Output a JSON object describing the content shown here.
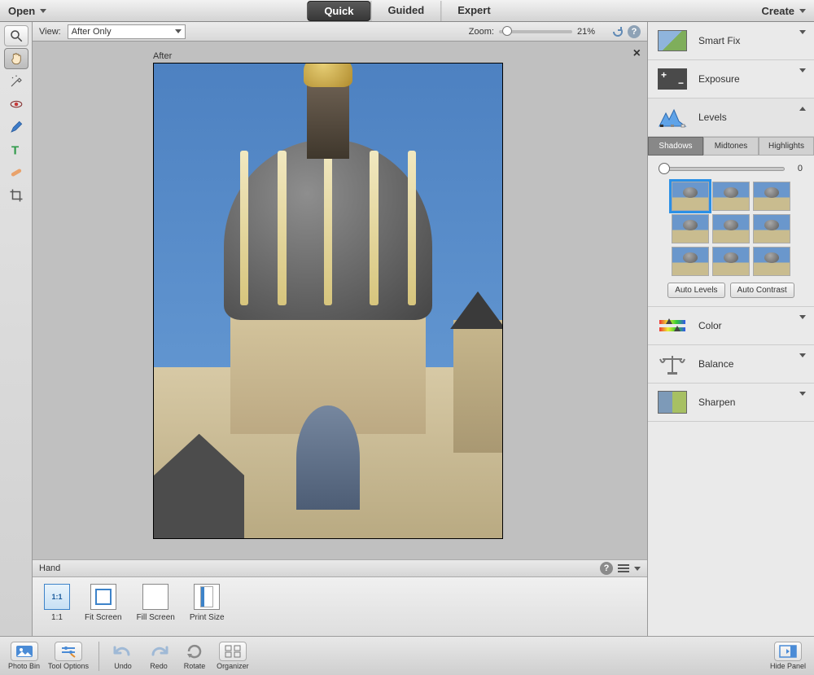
{
  "menubar": {
    "open": "Open",
    "modes": [
      "Quick",
      "Guided",
      "Expert"
    ],
    "active_mode": "Quick",
    "create": "Create"
  },
  "viewbar": {
    "view_label": "View:",
    "view_value": "After Only",
    "zoom_label": "Zoom:",
    "zoom_value": "21%"
  },
  "canvas": {
    "after_label": "After"
  },
  "handbar": {
    "title": "Hand"
  },
  "options": {
    "one_to_one": "1:1",
    "fit_screen": "Fit Screen",
    "fill_screen": "Fill Screen",
    "print_size": "Print Size"
  },
  "rightpanel": {
    "smart_fix": "Smart Fix",
    "exposure": "Exposure",
    "levels": "Levels",
    "color": "Color",
    "balance": "Balance",
    "sharpen": "Sharpen",
    "subtabs": {
      "shadows": "Shadows",
      "midtones": "Midtones",
      "highlights": "Highlights"
    },
    "slider_value": "0",
    "auto_levels": "Auto Levels",
    "auto_contrast": "Auto Contrast"
  },
  "taskbar": {
    "photo_bin": "Photo Bin",
    "tool_options": "Tool Options",
    "undo": "Undo",
    "redo": "Redo",
    "rotate": "Rotate",
    "organizer": "Organizer",
    "hide_panel": "Hide Panel"
  }
}
